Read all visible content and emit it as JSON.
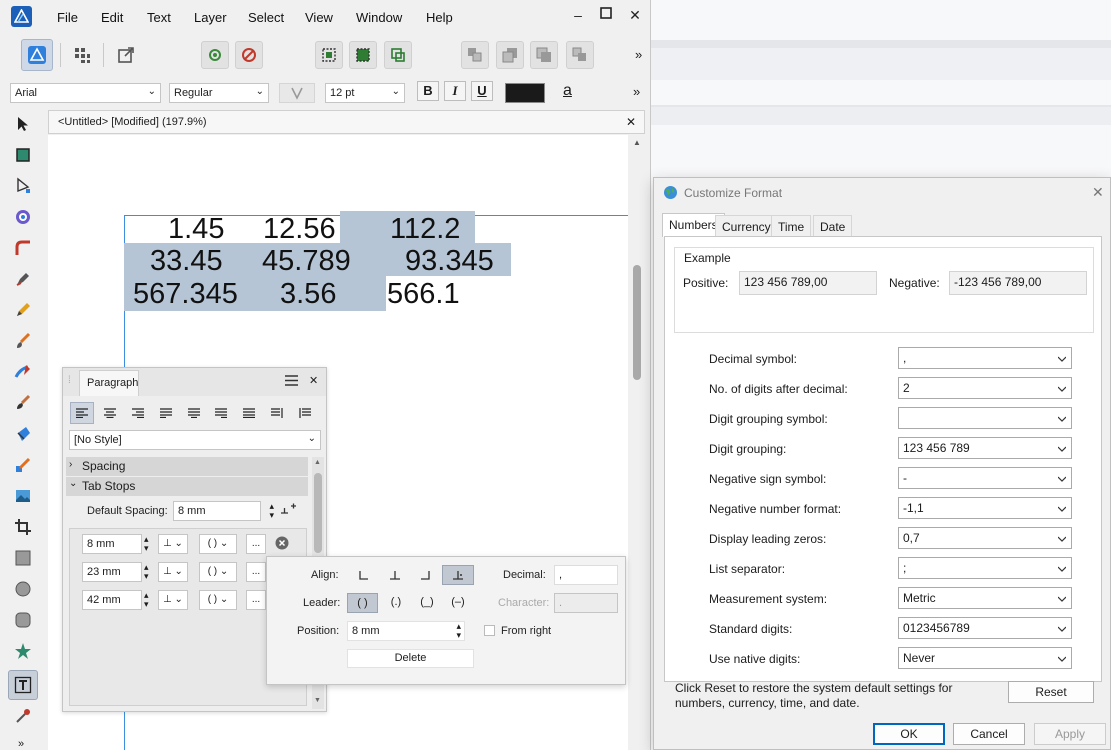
{
  "app": {
    "menu": [
      "File",
      "Edit",
      "Text",
      "Layer",
      "Select",
      "View",
      "Window",
      "Help"
    ],
    "more_glyph": "»"
  },
  "context_bar": {
    "font": "Arial",
    "style": "Regular",
    "size": "12 pt",
    "bold": "B",
    "italic": "I",
    "underline": "U",
    "fill_color": "#1a1a1a",
    "char_glyph": "a"
  },
  "document": {
    "tab_title": "<Untitled> [Modified] (197.9%)",
    "rows": [
      [
        "1.45",
        "12.56",
        "112.2"
      ],
      [
        "33.45",
        "45.789",
        "93.345"
      ],
      [
        "567.345",
        "3.56",
        "566.1"
      ]
    ],
    "selection_color": "#b5c5d6"
  },
  "paragraph": {
    "title": "Paragraph",
    "style": "[No Style]",
    "sections": [
      "Spacing",
      "Tab Stops"
    ],
    "default_spacing_label": "Default Spacing:",
    "default_spacing": "8 mm",
    "tab_stops": [
      "8 mm",
      "23 mm",
      "42 mm"
    ],
    "paren_glyph": "( )",
    "ellipsis": "..."
  },
  "tab_popup": {
    "align_label": "Align:",
    "decimal_label": "Decimal:",
    "decimal_value": ",",
    "leader_label": "Leader:",
    "leaders": [
      "( )",
      "(.)",
      "(_)",
      "(–)"
    ],
    "character_label": "Character:",
    "character_value": ".",
    "position_label": "Position:",
    "position_value": "8 mm",
    "from_right_label": "From right",
    "delete_label": "Delete"
  },
  "dialog": {
    "title": "Customize Format",
    "tabs": [
      "Numbers",
      "Currency",
      "Time",
      "Date"
    ],
    "example_label": "Example",
    "positive_label": "Positive:",
    "positive_value": "123 456 789,00",
    "negative_label": "Negative:",
    "negative_value": "-123 456 789,00",
    "settings": [
      {
        "label": "Decimal symbol:",
        "value": ","
      },
      {
        "label": "No. of digits after decimal:",
        "value": "2"
      },
      {
        "label": "Digit grouping symbol:",
        "value": ""
      },
      {
        "label": "Digit grouping:",
        "value": "123 456 789"
      },
      {
        "label": "Negative sign symbol:",
        "value": "-"
      },
      {
        "label": "Negative number format:",
        "value": "-1,1"
      },
      {
        "label": "Display leading zeros:",
        "value": "0,7"
      },
      {
        "label": "List separator:",
        "value": ";"
      },
      {
        "label": "Measurement system:",
        "value": "Metric"
      },
      {
        "label": "Standard digits:",
        "value": "0123456789"
      },
      {
        "label": "Use native digits:",
        "value": "Never"
      }
    ],
    "reset_note_1": "Click Reset to restore the system default settings for",
    "reset_note_2": "numbers, currency, time, and date.",
    "reset_label": "Reset",
    "ok_label": "OK",
    "cancel_label": "Cancel",
    "apply_label": "Apply"
  }
}
